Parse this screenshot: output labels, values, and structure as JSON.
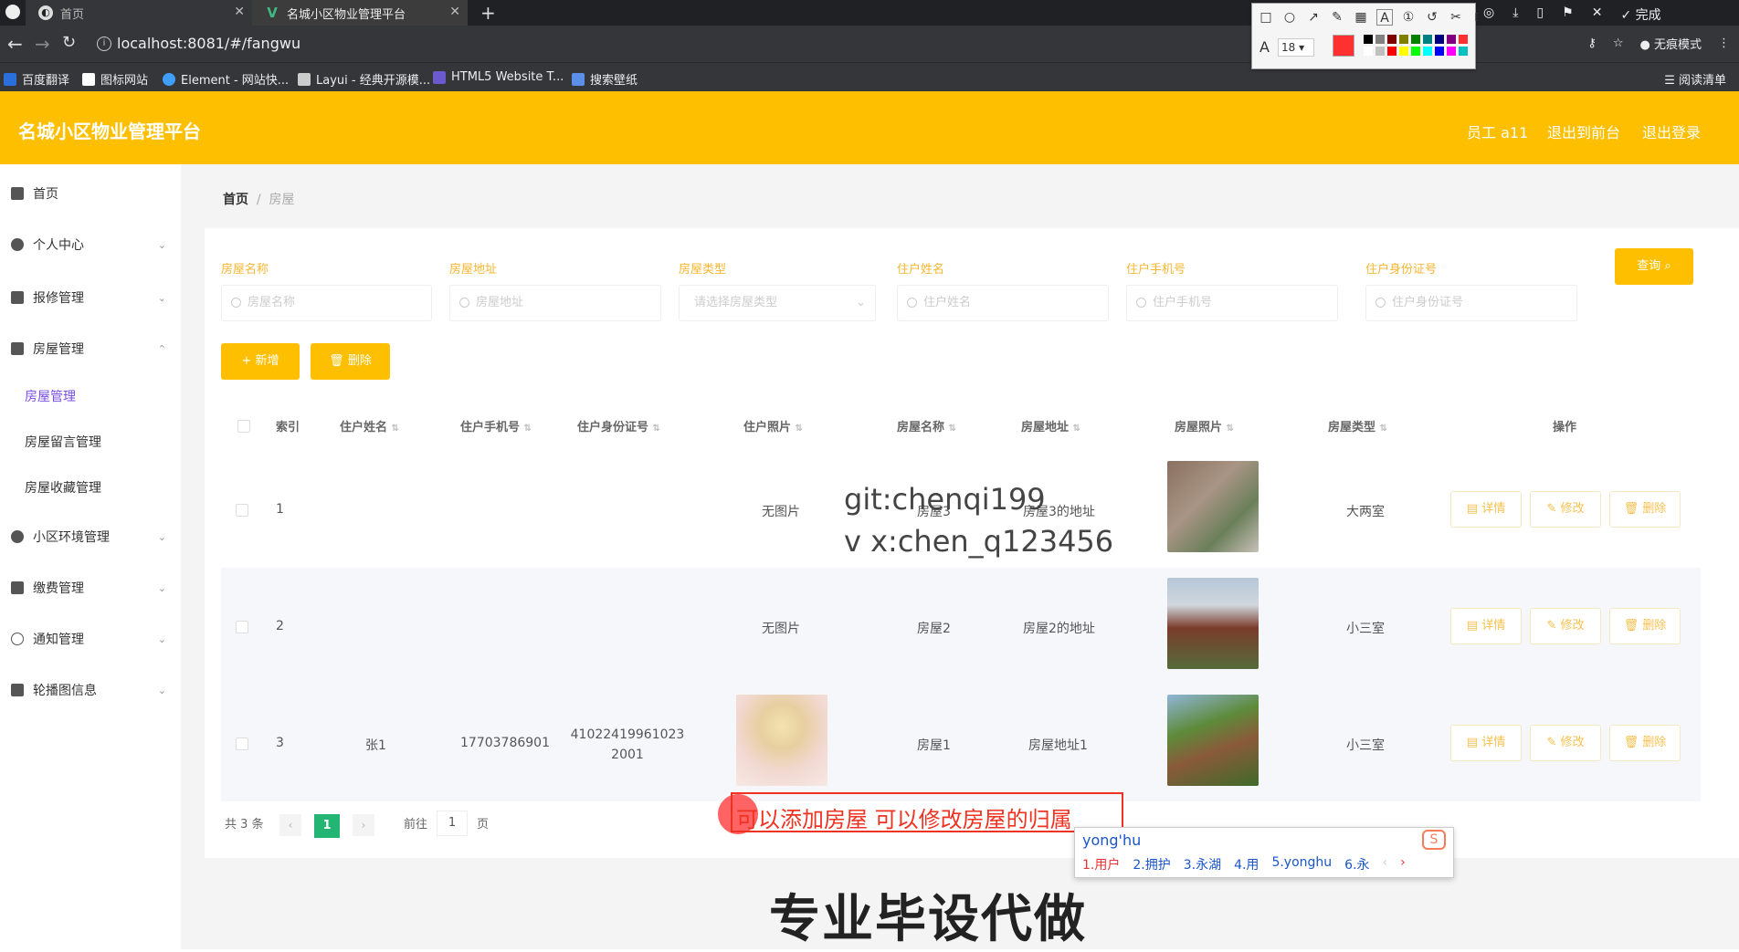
{
  "browser": {
    "tabs": [
      {
        "title": "首页"
      },
      {
        "title": "名城小区物业管理平台"
      }
    ],
    "url": "localhost:8081/#/fangwu",
    "bookmarks": [
      "百度翻译",
      "图标网站",
      "Element - 网站快...",
      "Layui - 经典开源模...",
      "HTML5 Website T...",
      "搜索壁纸"
    ],
    "reading_list": "阅读清单",
    "incognito": "无痕模式",
    "annot_font_size": "18",
    "annot_done": "完成",
    "annot_colors": [
      "#000000",
      "#808080",
      "#800000",
      "#808000",
      "#008000",
      "#008080",
      "#000080",
      "#800080",
      "#ff3030",
      "#ffffff",
      "#c0c0c0",
      "#ff0000",
      "#ffff00",
      "#00ff00",
      "#00ffff",
      "#0000ff",
      "#ff00ff",
      "#00c0c0"
    ]
  },
  "header": {
    "title": "名城小区物业管理平台",
    "user": "员工 a11",
    "to_front": "退出到前台",
    "logout": "退出登录"
  },
  "sidebar": {
    "items": [
      {
        "label": "首页"
      },
      {
        "label": "个人中心"
      },
      {
        "label": "报修管理"
      },
      {
        "label": "房屋管理"
      },
      {
        "label": "小区环境管理"
      },
      {
        "label": "缴费管理"
      },
      {
        "label": "通知管理"
      },
      {
        "label": "轮播图信息"
      }
    ],
    "sub": [
      "房屋管理",
      "房屋留言管理",
      "房屋收藏管理"
    ]
  },
  "breadcrumb": {
    "home": "首页",
    "current": "房屋"
  },
  "filters": [
    {
      "label": "房屋名称",
      "placeholder": "房屋名称"
    },
    {
      "label": "房屋地址",
      "placeholder": "房屋地址"
    },
    {
      "label": "房屋类型",
      "placeholder": "请选择房屋类型"
    },
    {
      "label": "住户姓名",
      "placeholder": "住户姓名"
    },
    {
      "label": "住户手机号",
      "placeholder": "住户手机号"
    },
    {
      "label": "住户身份证号",
      "placeholder": "住户身份证号"
    }
  ],
  "buttons": {
    "search": "查询",
    "add": "+ 新增",
    "delete": "删除"
  },
  "table": {
    "headers": [
      "索引",
      "住户姓名",
      "住户手机号",
      "住户身份证号",
      "住户照片",
      "房屋名称",
      "房屋地址",
      "房屋照片",
      "房屋类型",
      "操作"
    ],
    "rows": [
      {
        "index": "1",
        "name": "",
        "phone": "",
        "idcard": "",
        "photo": "无图片",
        "house": "房屋3",
        "addr": "房屋3的地址",
        "type": "大两室"
      },
      {
        "index": "2",
        "name": "",
        "phone": "",
        "idcard": "",
        "photo": "无图片",
        "house": "房屋2",
        "addr": "房屋2的地址",
        "type": "小三室"
      },
      {
        "index": "3",
        "name": "张1",
        "phone": "17703786901",
        "idcard": "410224199610232001",
        "photo": "",
        "house": "房屋1",
        "addr": "房屋地址1",
        "type": "小三室"
      }
    ],
    "ops": [
      "详情",
      "修改",
      "删除"
    ]
  },
  "pagination": {
    "total": "共 3 条",
    "current": "1",
    "goto": "前往",
    "goto_val": "1",
    "page_unit": "页"
  },
  "overlay": {
    "watermark1": "git:chenqi199",
    "watermark2": "v x:chen_q123456",
    "caption": "可以添加房屋 可以修改房屋的归属",
    "ime_input": "yong'hu",
    "ime_candidates": [
      "1.用户",
      "2.拥护",
      "3.永湖",
      "4.用",
      "5.yonghu",
      "6.永"
    ],
    "bottom_banner": "专业毕设代做"
  }
}
